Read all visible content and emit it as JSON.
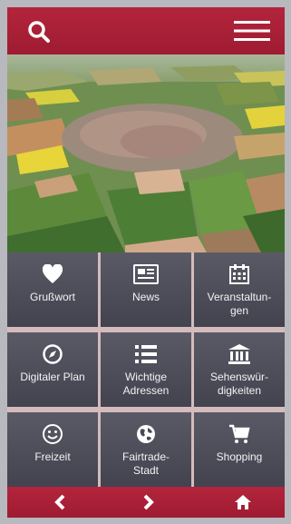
{
  "header": {
    "search_icon": "search-icon",
    "menu_icon": "hamburger-menu-icon",
    "accent_color": "#a8203a"
  },
  "hero": {
    "image": "aerial-town-photo"
  },
  "tiles": [
    {
      "label": "Grußwort",
      "icon": "heart-icon"
    },
    {
      "label": "News",
      "icon": "newspaper-icon"
    },
    {
      "label": "Veranstaltun-\ngen",
      "icon": "calendar-icon"
    },
    {
      "label": "Digitaler Plan",
      "icon": "compass-icon"
    },
    {
      "label": "Wichtige\nAdressen",
      "icon": "list-icon"
    },
    {
      "label": "Sehenswür-\ndigkeiten",
      "icon": "museum-icon"
    },
    {
      "label": "Freizeit",
      "icon": "smiley-icon"
    },
    {
      "label": "Fairtrade-\nStadt",
      "icon": "globe-icon"
    },
    {
      "label": "Shopping",
      "icon": "cart-icon"
    }
  ],
  "footer": {
    "back_icon": "chevron-left-icon",
    "forward_icon": "chevron-right-icon",
    "home_icon": "home-icon"
  }
}
